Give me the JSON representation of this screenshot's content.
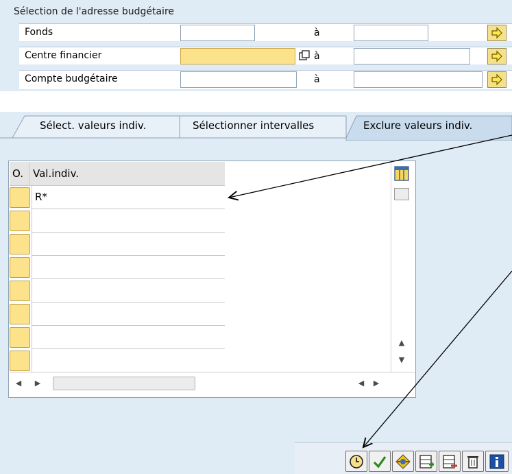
{
  "selection": {
    "title": "Sélection de l'adresse budgétaire",
    "to_label": "à",
    "rows": [
      {
        "label": "Fonds"
      },
      {
        "label": "Centre financier"
      },
      {
        "label": "Compte budgétaire"
      }
    ]
  },
  "tabs": [
    {
      "label": "Sélect. valeurs indiv."
    },
    {
      "label": "Sélectionner intervalles"
    },
    {
      "label": "Exclure valeurs indiv."
    }
  ],
  "table": {
    "headers": {
      "option": "O.",
      "value": "Val.indiv."
    },
    "rows": [
      {
        "value": "R*"
      },
      {
        "value": ""
      },
      {
        "value": ""
      },
      {
        "value": ""
      },
      {
        "value": ""
      },
      {
        "value": ""
      },
      {
        "value": ""
      },
      {
        "value": ""
      }
    ]
  },
  "toolbar": {
    "buttons": [
      "clock-icon",
      "check-icon",
      "multi-select-icon",
      "insert-row-icon",
      "delete-row-icon",
      "trash-icon",
      "info-icon"
    ]
  },
  "colors": {
    "panel_bg": "#dfebf5",
    "input_yellow": "#fce28a",
    "arrow_button": "#f5e18b",
    "active_tab": "#c9dced",
    "header_gray": "#e5e5e5"
  }
}
